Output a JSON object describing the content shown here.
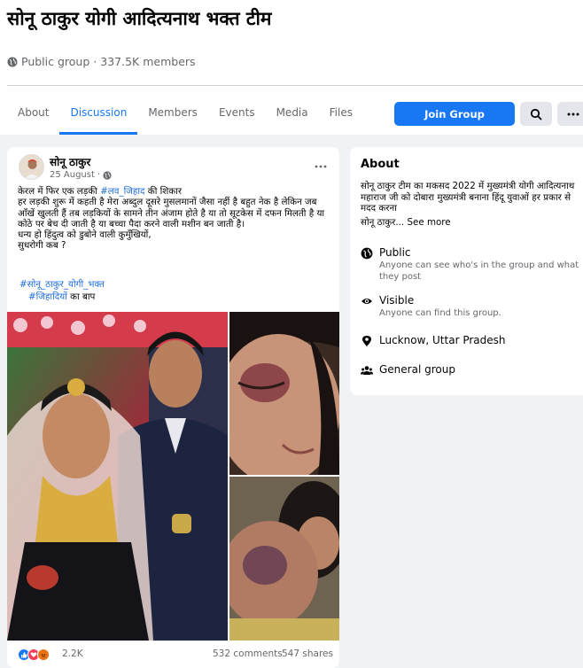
{
  "group": {
    "title": "सोनू ठाकुर योगी आदित्यनाथ भक्त टीम",
    "privacy": "Public group",
    "members": "337.5K members"
  },
  "tabs": [
    {
      "label": "About"
    },
    {
      "label": "Discussion"
    },
    {
      "label": "Members"
    },
    {
      "label": "Events"
    },
    {
      "label": "Media"
    },
    {
      "label": "Files"
    }
  ],
  "actions": {
    "join_label": "Join Group"
  },
  "post": {
    "author": "सोनू ठाकुर",
    "date": "25 August",
    "text_prefix": "केरल में फिर एक लड़की ",
    "text_tag": "#लव_जिहाद",
    "text_body_suffix": " की शिकार\nहर लड़की शुरू में कहती है मेरा अब्दुल दूसरे मुसलमानों जैसा नहीं है बहुत नेक है लेकिन जब आँखें खुलती हैं तब लड़कियों के सामने तीन अंजाम होते है या तो सूटकेस में दफन मिलती है या कोठे पर बेच दी जाती है या बच्चा पैदा करने वाली मशीन बन जाती है।\nधन्य हो हिंदुत्व को डुबोने वाली कुमुँखियों,\nसुधरोगी कब ?",
    "hashtag_1": "#सोनू_ठाकुर_योगी_भक्त",
    "hashtag_2": "#जिहादियों",
    "hashtag_2_suffix": " का बाप",
    "reaction_count": "2.2K",
    "comments": "532 comments",
    "shares": "547 shares"
  },
  "about": {
    "title": "About",
    "description": "सोनू ठाकुर टीम का मकसद 2022 में मुख्यमंत्री योगी आदित्यनाथ महाराज जी को दोबारा मुख्यमंत्री बनाना हिंदू युवाओं हर प्रकार से मदद करना",
    "desc_short": "सोनू ठाकुर...",
    "see_more": " See more",
    "public_title": "Public",
    "public_sub": "Anyone can see who's in the group and what they post",
    "visible_title": "Visible",
    "visible_sub": "Anyone can find this group.",
    "location": "Lucknow, Uttar Pradesh",
    "group_type": "General group"
  },
  "colors": {
    "accent": "#1877f2",
    "background": "#f0f2f5",
    "secondary_text": "#65676b"
  },
  "icons": [
    "globe-icon",
    "search-icon",
    "more-icon",
    "eye-icon",
    "location-pin-icon",
    "people-icon",
    "like-icon",
    "love-icon",
    "angry-icon"
  ]
}
